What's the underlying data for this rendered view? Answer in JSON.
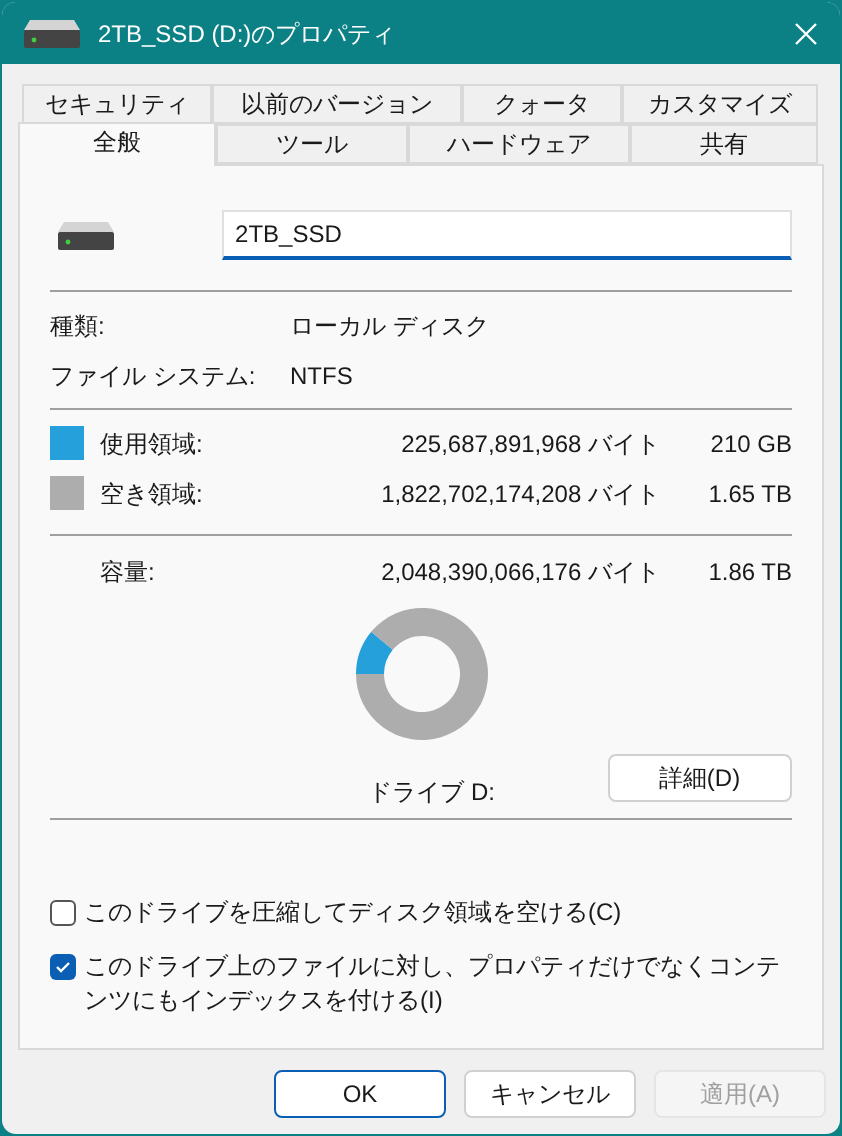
{
  "window": {
    "title": "2TB_SSD (D:)のプロパティ"
  },
  "tab_rows": [
    [
      {
        "label": "セキュリティ",
        "selected": false
      },
      {
        "label": "以前のバージョン",
        "selected": false
      },
      {
        "label": "クォータ",
        "selected": false
      },
      {
        "label": "カスタマイズ",
        "selected": false
      }
    ],
    [
      {
        "label": "全般",
        "selected": true
      },
      {
        "label": "ツール",
        "selected": false
      },
      {
        "label": "ハードウェア",
        "selected": false
      },
      {
        "label": "共有",
        "selected": false
      }
    ]
  ],
  "name_field": {
    "value": "2TB_SSD"
  },
  "info": [
    {
      "label": "種類:",
      "value": "ローカル ディスク"
    },
    {
      "label": "ファイル システム:",
      "value": "NTFS"
    }
  ],
  "space": [
    {
      "label": "使用領域:",
      "bytes": "225,687,891,968 バイト",
      "size": "210 GB",
      "color": "#26a0da"
    },
    {
      "label": "空き領域:",
      "bytes": "1,822,702,174,208 バイト",
      "size": "1.65 TB",
      "color": "#adadad"
    }
  ],
  "capacity": {
    "label": "容量:",
    "bytes": "2,048,390,066,176 バイト",
    "size": "1.86 TB"
  },
  "usage_chart": {
    "chart_data": {
      "type": "donut",
      "values": [
        11.02,
        88.98
      ]
    }
  },
  "drive_label": "ドライブ D:",
  "details_button": "詳細(D)",
  "options": [
    {
      "label": "このドライブを圧縮してディスク領域を空ける(C)",
      "checked": false
    },
    {
      "label": "このドライブ上のファイルに対し、プロパティだけでなくコンテンツにもインデックスを付ける(I)",
      "checked": true
    }
  ],
  "buttons": [
    {
      "label": "OK",
      "kind": "default",
      "disabled": false
    },
    {
      "label": "キャンセル",
      "kind": "normal",
      "disabled": false
    },
    {
      "label": "適用(A)",
      "kind": "normal",
      "disabled": true
    }
  ]
}
